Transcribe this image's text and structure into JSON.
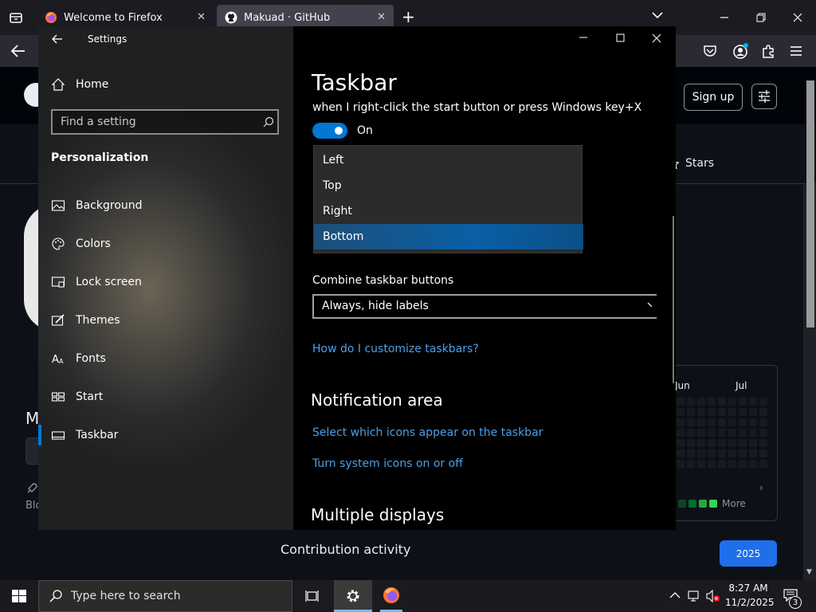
{
  "firefox": {
    "tabs": [
      {
        "title": "Welcome to Firefox",
        "icon": "firefox-icon",
        "active": false
      },
      {
        "title": "Makuad · GitHub",
        "icon": "github-icon",
        "active": true
      }
    ],
    "new_tab": "+",
    "close_glyph": "✕"
  },
  "github": {
    "sign_up": "Sign up",
    "stars_label": "Stars",
    "partial_letter": "M",
    "partial_blog": "Blo",
    "months": [
      "Jun",
      "Jul"
    ],
    "more_label": "More",
    "contribution_heading": "Contribution activity",
    "year_button": "2025",
    "partial_bottom_text": "...",
    "accent": "#1f6feb"
  },
  "settings": {
    "window_title": "Settings",
    "home": "Home",
    "search_placeholder": "Find a setting",
    "section": "Personalization",
    "nav": [
      {
        "label": "Background",
        "icon": "background-picture-icon"
      },
      {
        "label": "Colors",
        "icon": "palette-icon"
      },
      {
        "label": "Lock screen",
        "icon": "lock-screen-icon"
      },
      {
        "label": "Themes",
        "icon": "themes-brush-icon"
      },
      {
        "label": "Fonts",
        "icon": "fonts-icon"
      },
      {
        "label": "Start",
        "icon": "start-grid-icon"
      },
      {
        "label": "Taskbar",
        "icon": "taskbar-icon",
        "selected": true
      }
    ],
    "page_title": "Taskbar",
    "toggle_desc": "when I right-click the start button or press Windows key+X",
    "toggle_state": "On",
    "position_options": [
      "Left",
      "Top",
      "Right",
      "Bottom"
    ],
    "position_selected": "Bottom",
    "combine_label": "Combine taskbar buttons",
    "combine_value": "Always, hide labels",
    "customize_link": "How do I customize taskbars?",
    "notification_heading": "Notification area",
    "notif_link1": "Select which icons appear on the taskbar",
    "notif_link2": "Turn system icons on or off",
    "multiple_heading": "Multiple displays",
    "accent": "#0078d4",
    "link_color": "#4c9fe8"
  },
  "taskbar": {
    "search_placeholder": "Type here to search",
    "time": "8:27 AM",
    "date": "11/2/2025",
    "notification_count": "3"
  }
}
